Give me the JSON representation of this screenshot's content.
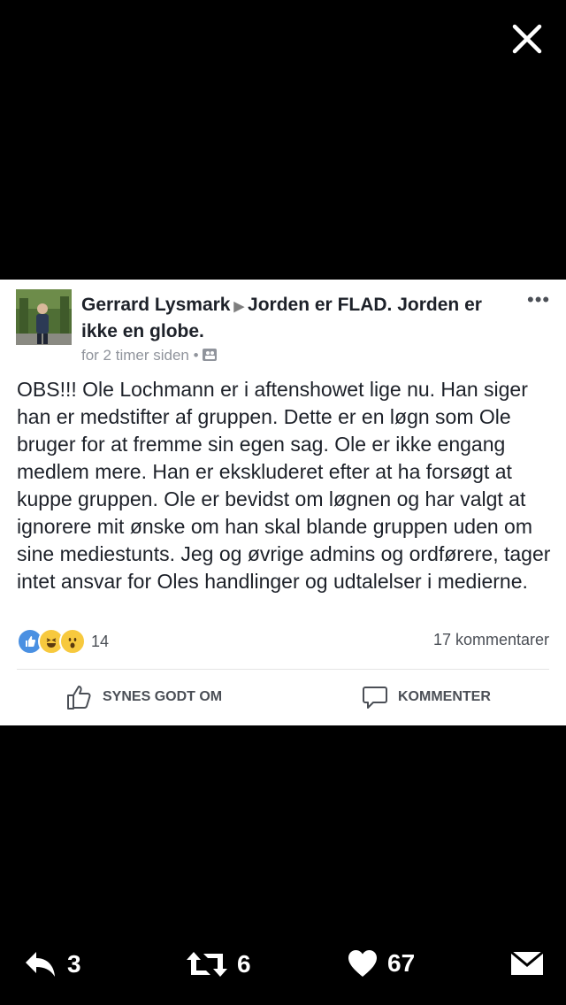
{
  "post": {
    "author": "Gerrard Lysmark",
    "group": "Jorden er FLAD. Jorden er ikke en globe.",
    "time": "for 2 timer siden",
    "separator": "•",
    "text": "OBS!!! Ole Lochmann er i aftenshowet lige nu. Han siger han er medstifter af gruppen. Dette er en løgn som Ole bruger for at fremme sin egen sag. Ole er ikke engang medlem mere. Han er ekskluderet efter at ha forsøgt at kuppe gruppen. Ole er bevidst om løgnen og har valgt at ignorere mit ønske om han skal blande gruppen uden om sine mediestunts. Jeg og øvrige admins og ordførere, tager intet ansvar for Oles handlinger og udtalelser i medierne.",
    "reaction_count": "14",
    "comments_label": "17 kommentarer",
    "like_label": "SYNES GODT OM",
    "comment_label": "KOMMENTER"
  },
  "tweet_actions": {
    "reply_count": "3",
    "retweet_count": "6",
    "like_count": "67"
  },
  "icons": [
    "close-icon",
    "more-icon",
    "group-icon",
    "like-reaction-icon",
    "haha-reaction-icon",
    "wow-reaction-icon",
    "thumbs-up-icon",
    "comment-icon",
    "reply-icon",
    "retweet-icon",
    "heart-icon",
    "mail-icon"
  ]
}
